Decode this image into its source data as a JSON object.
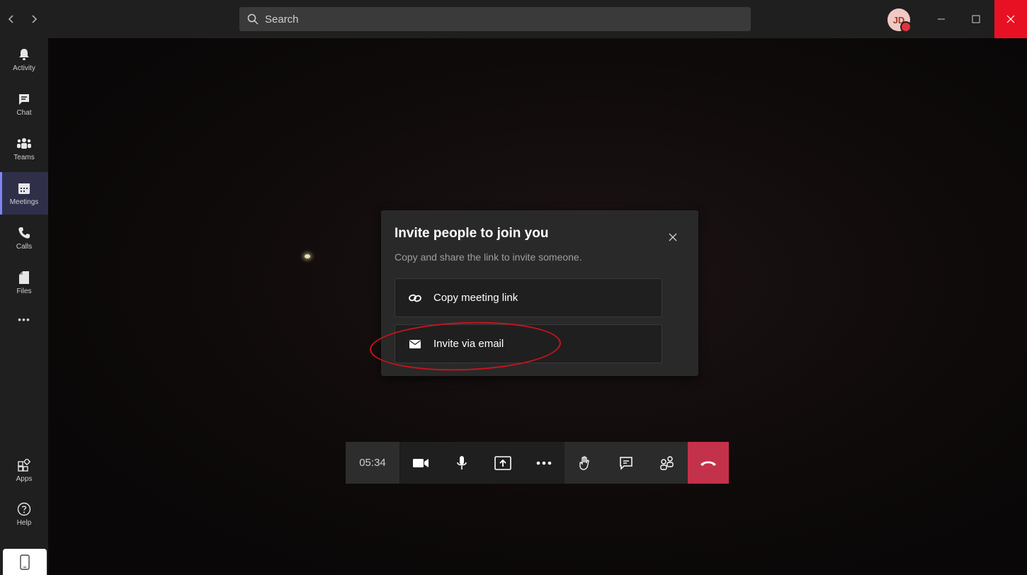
{
  "titlebar": {
    "search_placeholder": "Search",
    "avatar_initials": "JD",
    "avatar_status_color": "#e0333f",
    "close_color": "#e81123"
  },
  "rail": {
    "items": [
      {
        "label": "Activity",
        "icon": "bell-icon"
      },
      {
        "label": "Chat",
        "icon": "chat-icon"
      },
      {
        "label": "Teams",
        "icon": "teams-icon"
      },
      {
        "label": "Meetings",
        "icon": "calendar-icon",
        "active": true
      },
      {
        "label": "Calls",
        "icon": "phone-icon"
      },
      {
        "label": "Files",
        "icon": "file-icon"
      }
    ],
    "more_label": "•••",
    "bottom_items": [
      {
        "label": "Apps",
        "icon": "apps-icon"
      },
      {
        "label": "Help",
        "icon": "help-icon"
      }
    ],
    "accent_color": "#7f85f5"
  },
  "dialog": {
    "title": "Invite people to join you",
    "subtitle": "Copy and share the link to invite someone.",
    "copy_link_label": "Copy meeting link",
    "email_label": "Invite via email"
  },
  "callbar": {
    "timer": "05:34",
    "hangup_color": "#c4314b"
  }
}
